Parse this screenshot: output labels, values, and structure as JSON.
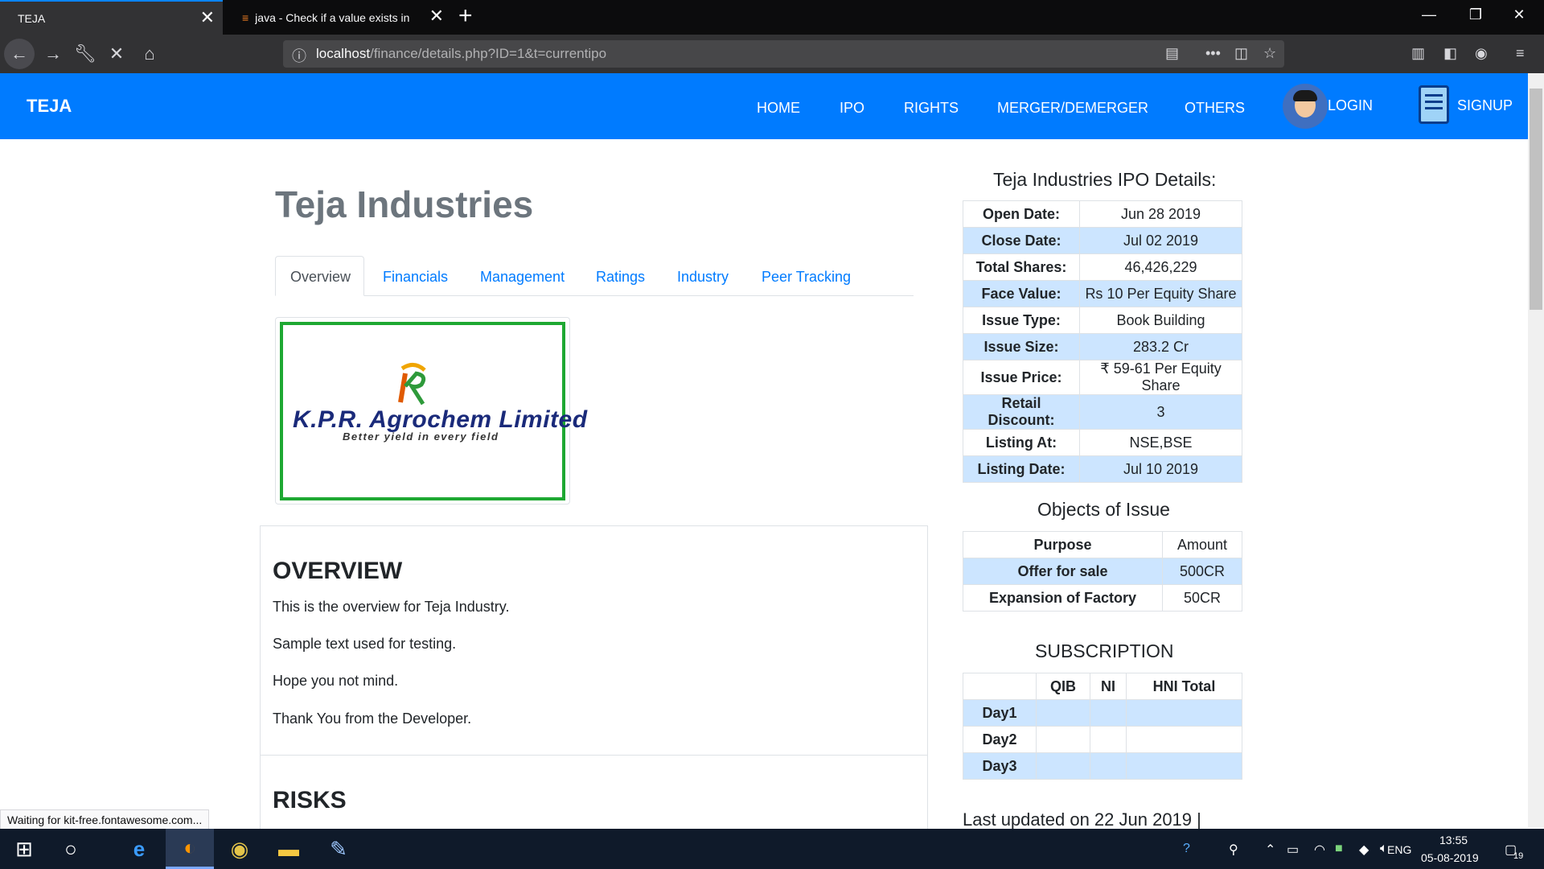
{
  "browser": {
    "tabs": [
      {
        "title": "TEJA",
        "close": "✕"
      },
      {
        "title": "java - Check if a value exists in",
        "close": "✕"
      }
    ],
    "new_tab": "+",
    "window_controls": {
      "minimize": "—",
      "restore": "❐",
      "close": "✕"
    },
    "url_host": "localhost",
    "url_path": "/finance/details.php?ID=1&t=currentipo",
    "status": "Waiting for kit-free.fontawesome.com..."
  },
  "site": {
    "brand": "TEJA",
    "menu": [
      "HOME",
      "IPO",
      "RIGHTS",
      "MERGER/DEMERGER",
      "OTHERS"
    ],
    "login": "LOGIN",
    "signup": "SIGNUP"
  },
  "company": {
    "title": "Teja Industries",
    "tabs": [
      "Overview",
      "Financials",
      "Management",
      "Ratings",
      "Industry",
      "Peer Tracking"
    ],
    "logo_text": "K.P.R. Agrochem Limited",
    "logo_tagline": "Better yield in every field",
    "overview_heading": "OVERVIEW",
    "overview_paragraphs": [
      "This is the overview for Teja Industry.",
      "Sample text used for testing.",
      "Hope you not mind.",
      "Thank You from the Developer."
    ],
    "risks_heading": "RISKS"
  },
  "ipo": {
    "heading": "Teja Industries IPO Details:",
    "details": [
      {
        "key": "Open Date:",
        "value": "Jun 28 2019"
      },
      {
        "key": "Close Date:",
        "value": "Jul 02 2019"
      },
      {
        "key": "Total Shares:",
        "value": "46,426,229"
      },
      {
        "key": "Face Value:",
        "value": "Rs 10 Per Equity Share"
      },
      {
        "key": "Issue Type:",
        "value": "Book Building"
      },
      {
        "key": "Issue Size:",
        "value": "283.2 Cr"
      },
      {
        "key": "Issue Price:",
        "value": "₹ 59-61 Per Equity Share"
      },
      {
        "key": "Retail Discount:",
        "value": "3"
      },
      {
        "key": "Listing At:",
        "value": "NSE,BSE"
      },
      {
        "key": "Listing Date:",
        "value": "Jul 10 2019"
      }
    ],
    "objects_heading": "Objects of Issue",
    "objects_header": {
      "purpose": "Purpose",
      "amount": "Amount"
    },
    "objects": [
      {
        "purpose": "Offer for sale",
        "amount": "500CR"
      },
      {
        "purpose": "Expansion of Factory",
        "amount": "50CR"
      }
    ],
    "subscription_heading": "SUBSCRIPTION",
    "subscription_header": [
      "",
      "QIB",
      "NI",
      "HNI Total"
    ],
    "subscription_days": [
      "Day1",
      "Day2",
      "Day3"
    ],
    "last_updated": "Last updated on 22 Jun 2019 |"
  },
  "taskbar": {
    "lang": "ENG",
    "time": "13:55",
    "date": "05-08-2019",
    "notifications": "19"
  },
  "colors": {
    "accent": "#007bff",
    "row_highlight": "#cce5ff",
    "logo_border": "#1ea832"
  }
}
